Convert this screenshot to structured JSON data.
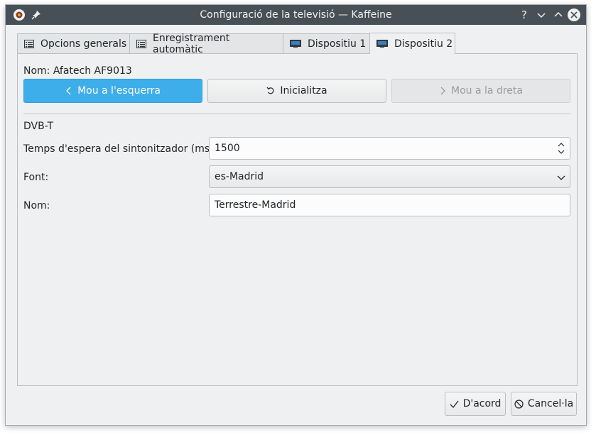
{
  "window": {
    "title": "Configuració de la televisió — Kaffeine"
  },
  "tabs": [
    {
      "label": "Opcions generals",
      "icon": "list-icon",
      "active": false
    },
    {
      "label": "Enregistrament automàtic",
      "icon": "list-icon",
      "active": false
    },
    {
      "label": "Dispositiu 1",
      "icon": "tv-icon",
      "active": false
    },
    {
      "label": "Dispositiu 2",
      "icon": "tv-icon",
      "active": true
    }
  ],
  "device": {
    "name_label": "Nom: Afatech AF9013",
    "move_left": "Mou a l'esquerra",
    "reset": "Inicialitza",
    "move_right": "Mou a la dreta"
  },
  "dvbt": {
    "section_label": "DVB-T",
    "timeout_label": "Temps d'espera del sintonitzador (ms):",
    "timeout_value": "1500",
    "source_label": "Font:",
    "source_value": "es-Madrid",
    "name_label": "Nom:",
    "name_value": "Terrestre-Madrid"
  },
  "dialog": {
    "ok": "D'acord",
    "cancel": "Cancel·la"
  },
  "colors": {
    "accent": "#3daee9",
    "titlebar": "#475057",
    "window_bg": "#eff0f1"
  }
}
